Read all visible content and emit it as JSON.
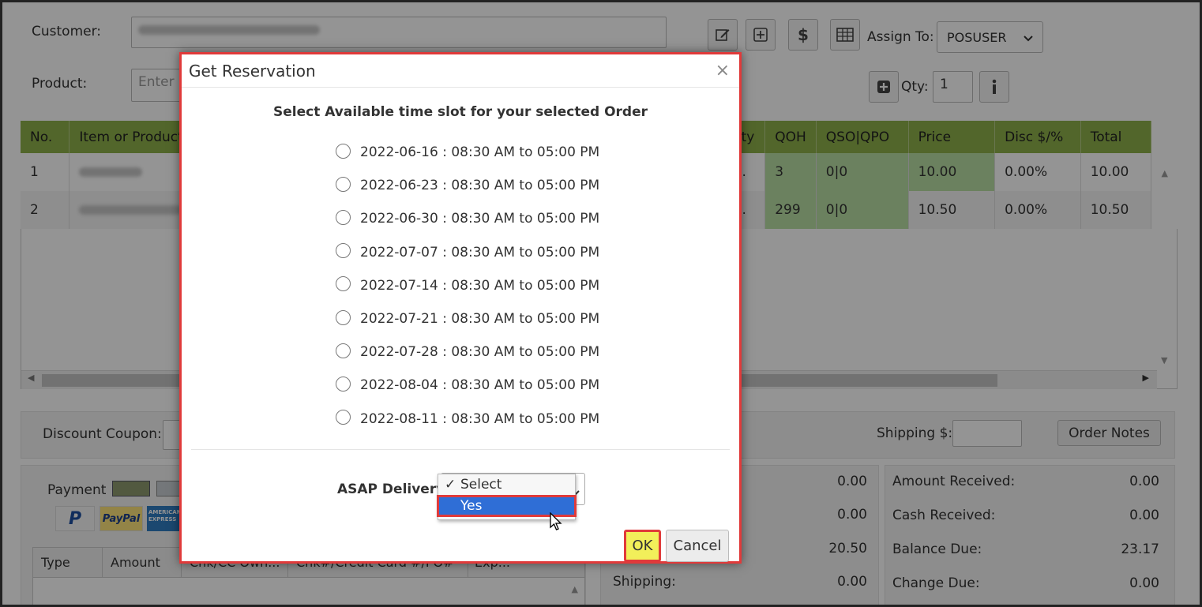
{
  "header": {
    "customer_label": "Customer:",
    "product_label": "Product:",
    "product_placeholder": "Enter",
    "assign_to_label": "Assign To:",
    "assign_to_value": "POSUSER",
    "qty_label": "Qty:",
    "qty_value": "1"
  },
  "grid": {
    "columns": [
      "No.",
      "Item or Product",
      "Qty",
      "QOH",
      "QSO|QPO",
      "Price",
      "Disc $/%",
      "Total"
    ],
    "rows": [
      {
        "no": "1",
        "qty": "....",
        "qoh": "3",
        "qso": "0|0",
        "price": "10.00",
        "disc": "0.00%",
        "total": "10.00"
      },
      {
        "no": "2",
        "qty": "....",
        "qoh": "299",
        "qso": "0|0",
        "price": "10.50",
        "disc": "0.00%",
        "total": "10.50"
      }
    ]
  },
  "lower": {
    "discount_coupon_label": "Discount Coupon:",
    "shipping_label": "Shipping $:",
    "order_notes_label": "Order Notes",
    "payment_label": "Payment",
    "paypal_label": "PayPal",
    "amex_label": "AMERICAN EXPRESS",
    "payment_table_headers": [
      "Type",
      "Amount",
      "Chk/CC Own...",
      "Chk#/Credit Card #/PO#",
      "Exp..."
    ],
    "middle_values": [
      "0.00",
      "0.00",
      "20.50"
    ],
    "shipping_row_label": "Shipping:",
    "shipping_row_value": "0.00",
    "summary": [
      {
        "label": "Amount Received:",
        "value": "0.00"
      },
      {
        "label": "Cash Received:",
        "value": "0.00"
      },
      {
        "label": "Balance Due:",
        "value": "23.17"
      },
      {
        "label": "Change Due:",
        "value": "0.00"
      }
    ]
  },
  "modal": {
    "title": "Get Reservation",
    "close": "×",
    "subtitle": "Select Available time slot for your selected Order",
    "slots": [
      "2022-06-16 : 08:30 AM to 05:00 PM",
      "2022-06-23 : 08:30 AM to 05:00 PM",
      "2022-06-30 : 08:30 AM to 05:00 PM",
      "2022-07-07 : 08:30 AM to 05:00 PM",
      "2022-07-14 : 08:30 AM to 05:00 PM",
      "2022-07-21 : 08:30 AM to 05:00 PM",
      "2022-07-28 : 08:30 AM to 05:00 PM",
      "2022-08-04 : 08:30 AM to 05:00 PM",
      "2022-08-11 : 08:30 AM to 05:00 PM"
    ],
    "asap_label": "ASAP Delivery",
    "dropdown_options": [
      "Select",
      "Yes"
    ],
    "dropdown_checked": "Select",
    "dropdown_highlighted": "Yes",
    "ok_label": "OK",
    "cancel_label": "Cancel"
  },
  "colors": {
    "grid_header": "#8db04a",
    "stock_cell": "#b9dfa4",
    "highlight_red": "#e03a3a",
    "ok_yellow": "#f2ef5a",
    "option_blue": "#2f6ed6"
  }
}
